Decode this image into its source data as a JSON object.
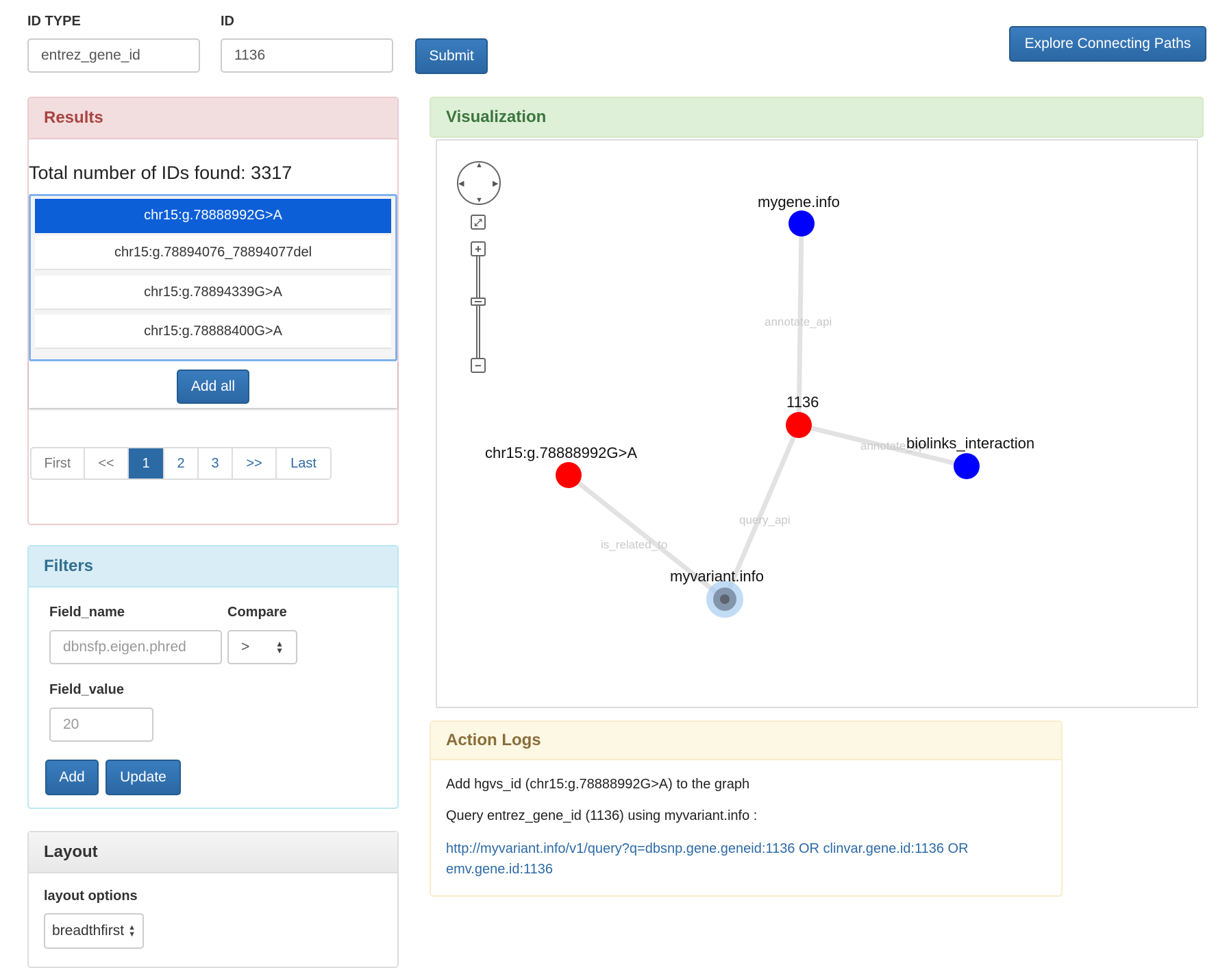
{
  "top": {
    "id_type_label": "ID TYPE",
    "id_type_value": "entrez_gene_id",
    "id_label": "ID",
    "id_value": "1136",
    "submit_label": "Submit",
    "explore_label": "Explore Connecting Paths"
  },
  "results": {
    "title": "Results",
    "total_text": "Total number of IDs found: 3317",
    "items": [
      "chr15:g.78888992G>A",
      "chr15:g.78894076_78894077del",
      "chr15:g.78894339G>A",
      "chr15:g.78888400G>A"
    ],
    "add_all_label": "Add all",
    "pager": [
      "First",
      "<<",
      "1",
      "2",
      "3",
      ">>",
      "Last"
    ],
    "current_page": "1"
  },
  "filters": {
    "title": "Filters",
    "field_name_label": "Field_name",
    "field_name_placeholder": "dbnsfp.eigen.phred",
    "compare_label": "Compare",
    "compare_value": ">",
    "field_value_label": "Field_value",
    "field_value_placeholder": "20",
    "add_label": "Add",
    "update_label": "Update"
  },
  "layout": {
    "title": "Layout",
    "options_label": "layout options",
    "selected": "breadthfirst"
  },
  "visualization": {
    "title": "Visualization",
    "nodes": [
      "mygene.info",
      "1136",
      "biolinks_interaction",
      "chr15:g.78888992G>A",
      "myvariant.info"
    ],
    "edges": [
      "annotate_api",
      "annotate_api",
      "query_api",
      "is_related_to"
    ]
  },
  "logs": {
    "title": "Action Logs",
    "line1": "Add hgvs_id (chr15:g.78888992G>A) to the graph",
    "line2": "Query entrez_gene_id (1136) using myvariant.info :",
    "link": "http://myvariant.info/v1/query?q=dbsnp.gene.geneid:1136 OR clinvar.gene.id:1136 OR emv.gene.id:1136"
  },
  "colors": {
    "primary": "#2c6aa6",
    "node_red": "#ff0000",
    "node_blue": "#0000ff",
    "results_head": "#f2dede",
    "viz_head": "#dff0d8",
    "filters_head": "#d9edf7",
    "logs_head": "#fcf8e3"
  }
}
